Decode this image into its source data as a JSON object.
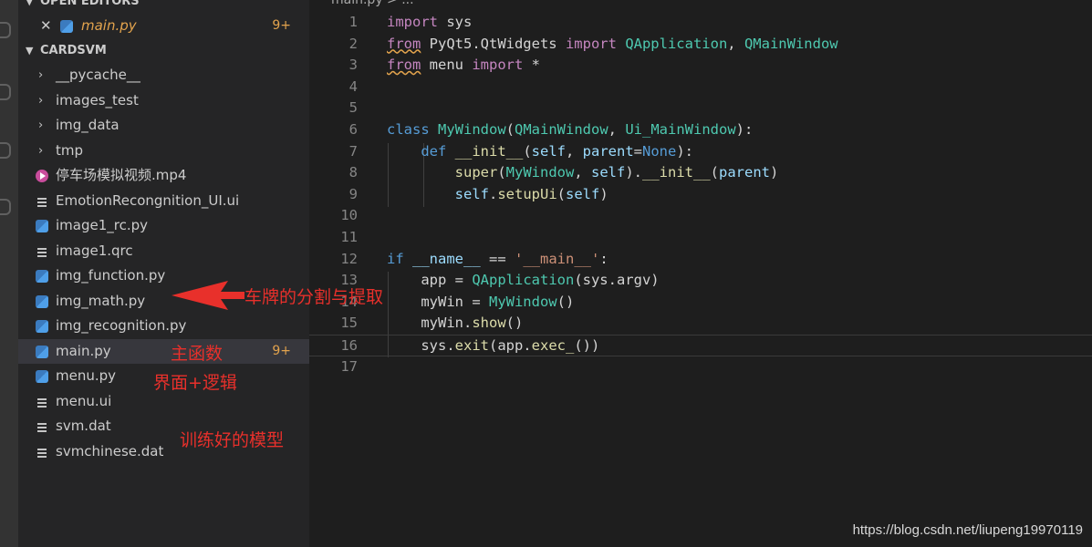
{
  "sidebar": {
    "open_editors_label": "OPEN EDITORS",
    "open_editor": {
      "name": "main.py",
      "badge": "9+"
    },
    "project_label": "CARDSVM",
    "items": [
      {
        "name": "__pycache__",
        "kind": "folder",
        "icon": "chevron-right-icon"
      },
      {
        "name": "images_test",
        "kind": "folder",
        "icon": "chevron-right-icon"
      },
      {
        "name": "img_data",
        "kind": "folder",
        "icon": "chevron-right-icon"
      },
      {
        "name": "tmp",
        "kind": "folder",
        "icon": "chevron-right-icon"
      },
      {
        "name": "停车场模拟视频.mp4",
        "kind": "file",
        "icon": "video-icon"
      },
      {
        "name": "EmotionRecongnition_UI.ui",
        "kind": "file",
        "icon": "file-lines-icon"
      },
      {
        "name": "image1_rc.py",
        "kind": "file",
        "icon": "python-icon"
      },
      {
        "name": "image1.qrc",
        "kind": "file",
        "icon": "file-lines-icon"
      },
      {
        "name": "img_function.py",
        "kind": "file",
        "icon": "python-icon"
      },
      {
        "name": "img_math.py",
        "kind": "file",
        "icon": "python-icon"
      },
      {
        "name": "img_recognition.py",
        "kind": "file",
        "icon": "python-icon"
      },
      {
        "name": "main.py",
        "kind": "file",
        "icon": "python-icon",
        "badge": "9+",
        "active": true
      },
      {
        "name": "menu.py",
        "kind": "file",
        "icon": "python-icon"
      },
      {
        "name": "menu.ui",
        "kind": "file",
        "icon": "file-lines-icon"
      },
      {
        "name": "svm.dat",
        "kind": "file",
        "icon": "file-lines-icon"
      },
      {
        "name": "svmchinese.dat",
        "kind": "file",
        "icon": "file-lines-icon"
      }
    ]
  },
  "editor": {
    "breadcrumb": "main.py > ...",
    "lines": [
      {
        "n": "1",
        "text": "import sys"
      },
      {
        "n": "2",
        "text": "from PyQt5.QtWidgets import QApplication, QMainWindow"
      },
      {
        "n": "3",
        "text": "from menu import *"
      },
      {
        "n": "4",
        "text": ""
      },
      {
        "n": "5",
        "text": ""
      },
      {
        "n": "6",
        "text": "class MyWindow(QMainWindow, Ui_MainWindow):"
      },
      {
        "n": "7",
        "text": "    def __init__(self, parent=None):"
      },
      {
        "n": "8",
        "text": "        super(MyWindow, self).__init__(parent)"
      },
      {
        "n": "9",
        "text": "        self.setupUi(self)"
      },
      {
        "n": "10",
        "text": ""
      },
      {
        "n": "11",
        "text": ""
      },
      {
        "n": "12",
        "text": "if __name__ == '__main__':"
      },
      {
        "n": "13",
        "text": "    app = QApplication(sys.argv)"
      },
      {
        "n": "14",
        "text": "    myWin = MyWindow()"
      },
      {
        "n": "15",
        "text": "    myWin.show()"
      },
      {
        "n": "16",
        "text": "    sys.exit(app.exec_())"
      },
      {
        "n": "17",
        "text": ""
      }
    ]
  },
  "annotations": {
    "plate": "车牌的分割与提取",
    "main": "主函数",
    "ui": "界面+逻辑",
    "model": "训练好的模型"
  },
  "watermark": "https://blog.csdn.net/liupeng19970119",
  "colors": {
    "annotation": "#e8302b",
    "badge": "#e2a34d",
    "keyword": "#569cd6",
    "class": "#4ec9b0"
  }
}
